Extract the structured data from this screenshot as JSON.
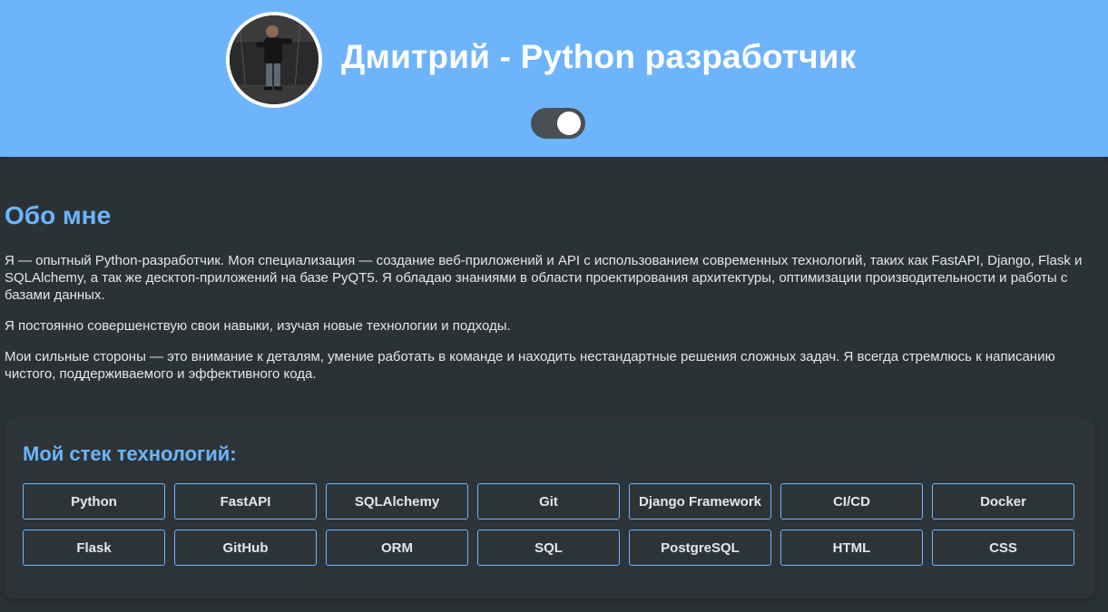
{
  "header": {
    "title": "Дмитрий - Python разработчик",
    "avatar_icon": "avatar-photo",
    "theme_toggle": {
      "state": "on",
      "color": "#4a4f55"
    }
  },
  "about": {
    "title": "Обо мне",
    "paragraphs": [
      "Я — опытный Python-разработчик. Моя специализация — создание веб-приложений и API с использованием современных технологий, таких как FastAPI, Django, Flask и SQLAlchemy, а так же десктоп-приложений на базе PyQT5. Я обладаю знаниями в области проектирования архитектуры, оптимизации производительности и работы с базами данных.",
      "Я постоянно совершенствую свои навыки, изучая новые технологии и подходы.",
      "Мои сильные стороны — это внимание к деталям, умение работать в команде и находить нестандартные решения сложных задач. Я всегда стремлюсь к написанию чистого, поддерживаемого и эффективного кода."
    ]
  },
  "stack": {
    "title": "Мой стек технологий:",
    "items": [
      "Python",
      "FastAPI",
      "SQLAlchemy",
      "Git",
      "Django Framework",
      "CI/CD",
      "Docker",
      "Flask",
      "GitHub",
      "ORM",
      "SQL",
      "PostgreSQL",
      "HTML",
      "CSS"
    ]
  },
  "colors": {
    "accent": "#6db4fd",
    "header_bg": "#6db4fd",
    "page_bg": "#2b3236",
    "text": "#e4e6e8"
  }
}
